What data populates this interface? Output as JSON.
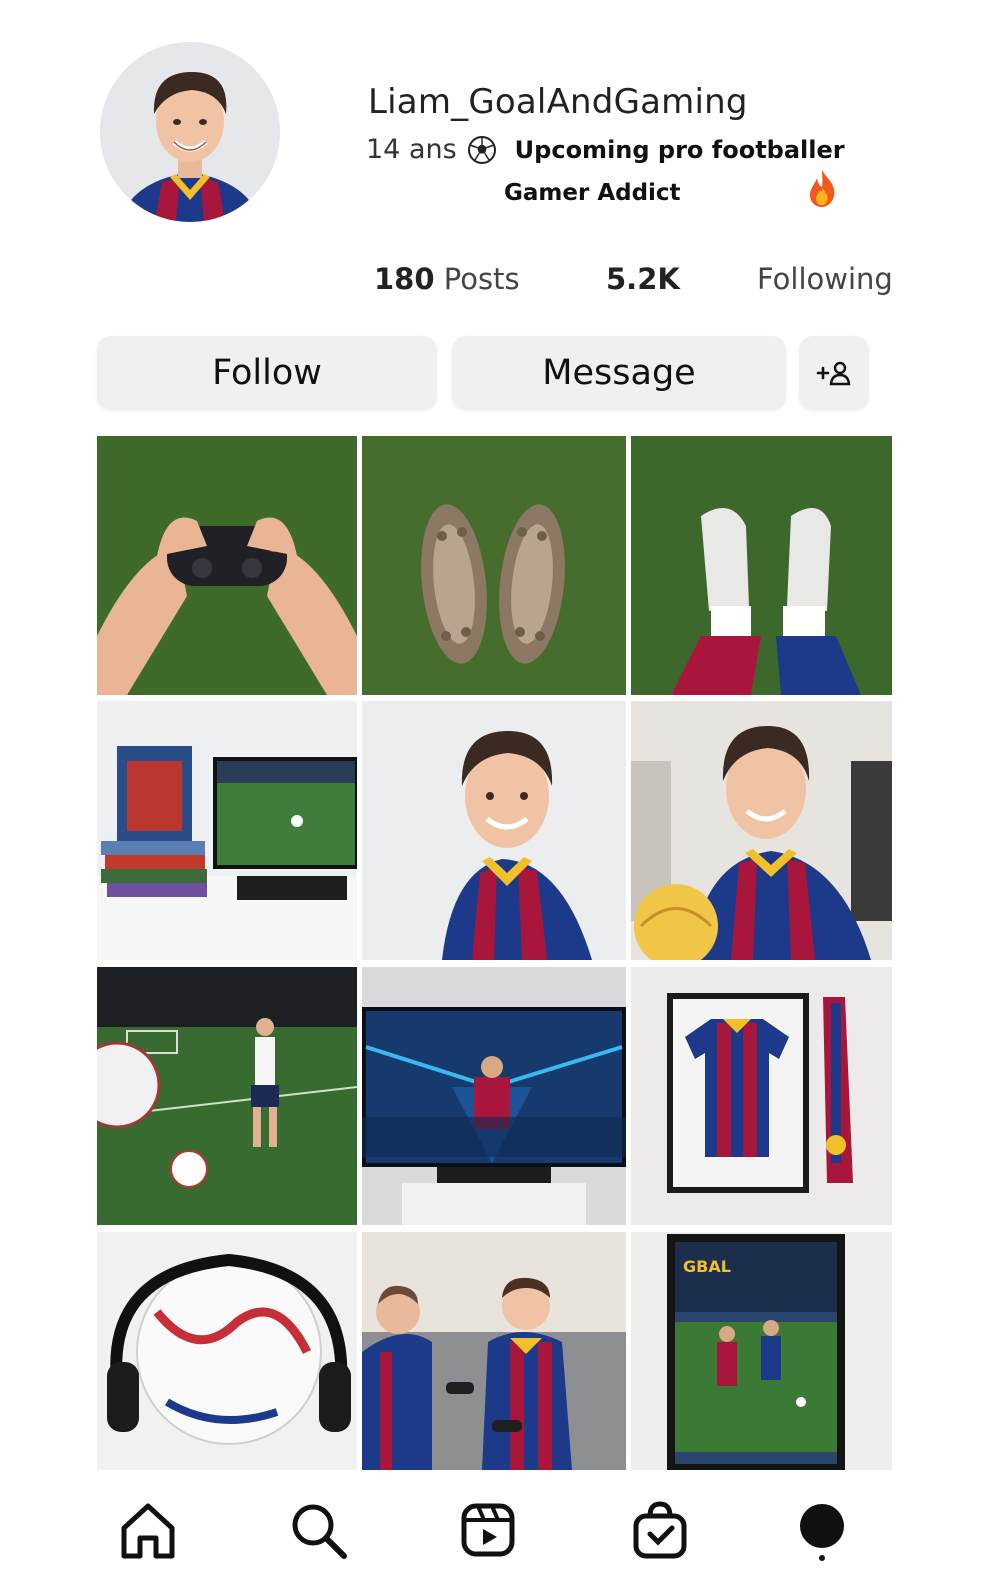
{
  "profile": {
    "username": "Liam_GoalAndGaming",
    "bio_line1_prefix": "14 ans",
    "bio_line1_tag": "Upcoming pro footballer",
    "bio_line2": "Gamer Addict"
  },
  "stats": {
    "posts_count": "180",
    "posts_label": "Posts",
    "followers_count": "5.2K",
    "following_label": "Following"
  },
  "actions": {
    "follow_label": "Follow",
    "message_label": "Message",
    "suggest_label": "+8"
  },
  "grid": [
    {
      "name": "post-controller-on-grass"
    },
    {
      "name": "post-muddy-boots"
    },
    {
      "name": "post-white-cleats"
    },
    {
      "name": "post-game-setup"
    },
    {
      "name": "post-selfie-jersey"
    },
    {
      "name": "post-selfie-store"
    },
    {
      "name": "post-match-play"
    },
    {
      "name": "post-tv-game"
    },
    {
      "name": "post-framed-jersey"
    },
    {
      "name": "post-ball-headphones"
    },
    {
      "name": "post-friends-gaming"
    },
    {
      "name": "post-poster"
    }
  ],
  "nav": {
    "items": [
      "home-icon",
      "search-icon",
      "reels-icon",
      "shop-icon",
      "profile-icon"
    ]
  },
  "colors": {
    "barca_blue": "#1d3a8a",
    "barca_red": "#a8163b",
    "barca_yellow": "#f2c028",
    "grass": "#3f6b2a"
  }
}
